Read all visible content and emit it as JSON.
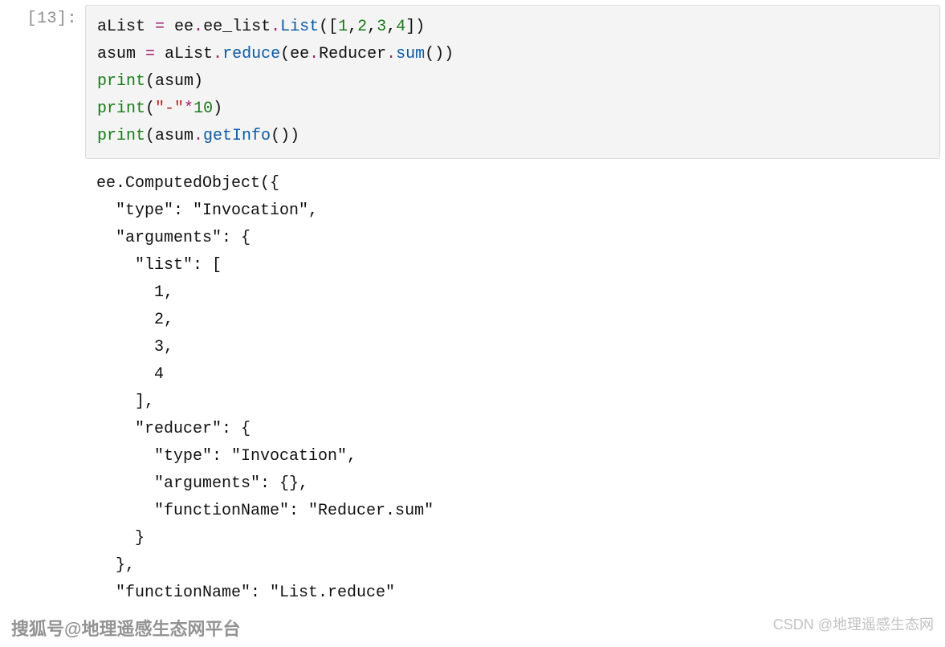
{
  "prompt": "[13]:",
  "code": {
    "l1": {
      "a": "aList ",
      "b": "= ",
      "c": "ee",
      "d": ".",
      "e": "ee_list",
      "f": ".",
      "g": "List",
      "h": "([",
      "i": "1",
      "j": ",",
      "k": "2",
      "l": ",",
      "m": "3",
      "n": ",",
      "o": "4",
      "p": "])"
    },
    "l2": {
      "a": "asum ",
      "b": "= ",
      "c": "aList",
      "d": ".",
      "e": "reduce",
      "f": "(ee",
      "g": ".",
      "h": "Reducer",
      "i": ".",
      "j": "sum",
      "k": "())"
    },
    "l3": {
      "a": "print",
      "b": "(asum)"
    },
    "l4": {
      "a": "print",
      "b": "(",
      "c": "\"-\"",
      "d": "*",
      "e": "10",
      "f": ")"
    },
    "l5": {
      "a": "print",
      "b": "(asum",
      "c": ".",
      "d": "getInfo",
      "e": "())"
    }
  },
  "output": "ee.ComputedObject({\n  \"type\": \"Invocation\",\n  \"arguments\": {\n    \"list\": [\n      1,\n      2,\n      3,\n      4\n    ],\n    \"reducer\": {\n      \"type\": \"Invocation\",\n      \"arguments\": {},\n      \"functionName\": \"Reducer.sum\"\n    }\n  },\n  \"functionName\": \"List.reduce\"",
  "watermark_left": "搜狐号@地理遥感生态网平台",
  "watermark_right": "CSDN @地理遥感生态网"
}
